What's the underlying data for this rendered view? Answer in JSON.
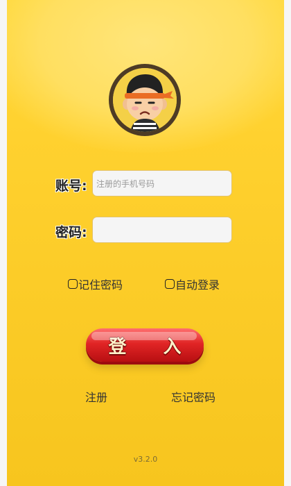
{
  "avatar": {
    "description_icon": "cartoon-boy-avatar"
  },
  "fields": {
    "account_label": "账号:",
    "account_placeholder": "注册的手机号码",
    "password_label": "密码:",
    "password_placeholder": ""
  },
  "options": {
    "remember_password": "记住密码",
    "auto_login": "自动登录"
  },
  "actions": {
    "login": "登 入",
    "register": "注册",
    "forgot_password": "忘记密码"
  },
  "version": "v3.2.0",
  "colors": {
    "background": "#ffd12f",
    "button": "#d91f24",
    "text": "#333333"
  }
}
